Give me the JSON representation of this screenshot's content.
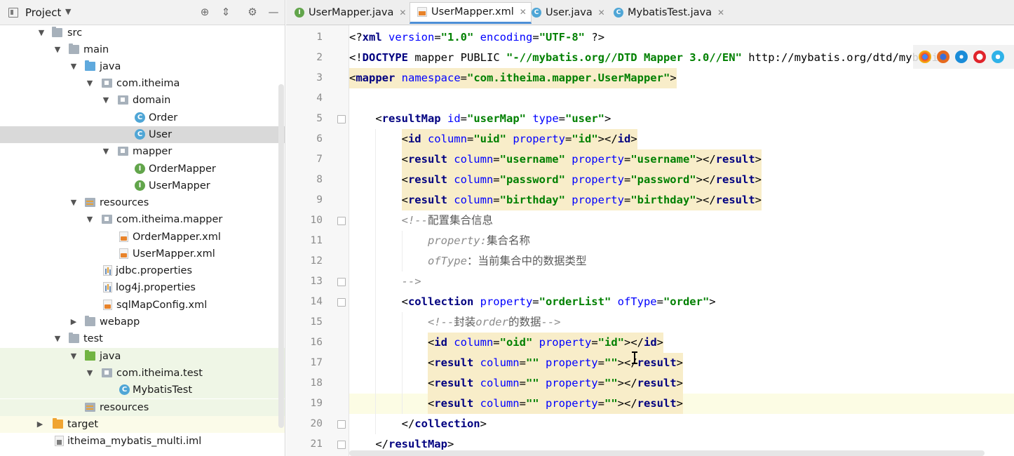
{
  "project_panel": {
    "title": "Project",
    "tree": [
      {
        "label": "src",
        "type": "folder",
        "expanded": true
      },
      {
        "label": "main",
        "type": "folder",
        "expanded": true
      },
      {
        "label": "java",
        "type": "source-folder",
        "expanded": true
      },
      {
        "label": "com.itheima",
        "type": "package",
        "expanded": true
      },
      {
        "label": "domain",
        "type": "package",
        "expanded": true
      },
      {
        "label": "Order",
        "type": "class"
      },
      {
        "label": "User",
        "type": "class",
        "selected": true
      },
      {
        "label": "mapper",
        "type": "package",
        "expanded": true
      },
      {
        "label": "OrderMapper",
        "type": "interface"
      },
      {
        "label": "UserMapper",
        "type": "interface"
      },
      {
        "label": "resources",
        "type": "resources-folder",
        "expanded": true
      },
      {
        "label": "com.itheima.mapper",
        "type": "package",
        "expanded": true
      },
      {
        "label": "OrderMapper.xml",
        "type": "xml"
      },
      {
        "label": "UserMapper.xml",
        "type": "xml"
      },
      {
        "label": "jdbc.properties",
        "type": "properties"
      },
      {
        "label": "log4j.properties",
        "type": "properties"
      },
      {
        "label": "sqlMapConfig.xml",
        "type": "xml"
      },
      {
        "label": "webapp",
        "type": "folder",
        "expanded": false
      },
      {
        "label": "test",
        "type": "folder",
        "expanded": true
      },
      {
        "label": "java",
        "type": "test-folder",
        "expanded": true
      },
      {
        "label": "com.itheima.test",
        "type": "package",
        "expanded": true
      },
      {
        "label": "MybatisTest",
        "type": "class"
      },
      {
        "label": "resources",
        "type": "resources-folder"
      },
      {
        "label": "target",
        "type": "excluded-folder",
        "expanded": false
      },
      {
        "label": "itheima_mybatis_multi.iml",
        "type": "iml"
      }
    ]
  },
  "tabs": [
    {
      "label": "UserMapper.java",
      "icon": "interface-icon",
      "active": false
    },
    {
      "label": "UserMapper.xml",
      "icon": "xml-file-icon",
      "active": true
    },
    {
      "label": "User.java",
      "icon": "class-icon",
      "active": false
    },
    {
      "label": "MybatisTest.java",
      "icon": "class-icon",
      "active": false
    }
  ],
  "editor": {
    "current_line": 19,
    "lines": [
      {
        "n": "1",
        "text": "<?xml version=\"1.0\" encoding=\"UTF-8\" ?>"
      },
      {
        "n": "2",
        "text": "<!DOCTYPE mapper PUBLIC \"-//mybatis.org//DTD Mapper 3.0//EN\" \"http://mybatis.org/dtd/mybatis"
      },
      {
        "n": "3",
        "text": "<mapper namespace=\"com.itheima.mapper.UserMapper\">"
      },
      {
        "n": "4",
        "text": ""
      },
      {
        "n": "5",
        "text": "<resultMap id=\"userMap\" type=\"user\">"
      },
      {
        "n": "6",
        "text": "<id column=\"uid\" property=\"id\"></id>"
      },
      {
        "n": "7",
        "text": "<result column=\"username\" property=\"username\"></result>"
      },
      {
        "n": "8",
        "text": "<result column=\"password\" property=\"password\"></result>"
      },
      {
        "n": "9",
        "text": "<result column=\"birthday\" property=\"birthday\"></result>"
      },
      {
        "n": "10",
        "text": "<!--配置集合信息"
      },
      {
        "n": "11",
        "text": "property:集合名称"
      },
      {
        "n": "12",
        "text": "ofType：当前集合中的数据类型"
      },
      {
        "n": "13",
        "text": "-->"
      },
      {
        "n": "14",
        "text": "<collection property=\"orderList\" ofType=\"order\">"
      },
      {
        "n": "15",
        "text": "<!--封装order的数据-->"
      },
      {
        "n": "16",
        "text": "<id column=\"oid\" property=\"id\"></id>"
      },
      {
        "n": "17",
        "text": "<result column=\"\" property=\"\"></result>"
      },
      {
        "n": "18",
        "text": "<result column=\"\" property=\"\"></result>"
      },
      {
        "n": "19",
        "text": "<result column=\"\" property=\"\"></result>"
      },
      {
        "n": "20",
        "text": "</collection>"
      },
      {
        "n": "21",
        "text": "</resultMap>"
      }
    ]
  },
  "colors": {
    "tag": "#000080",
    "attribute": "#0000ff",
    "value": "#008000",
    "comment": "#8c8c8c",
    "tag_highlight": "#f8edc9",
    "current_line": "#fcfce4",
    "selection": "#d9d9d9",
    "active_tab_accent": "#4d8fd6"
  }
}
